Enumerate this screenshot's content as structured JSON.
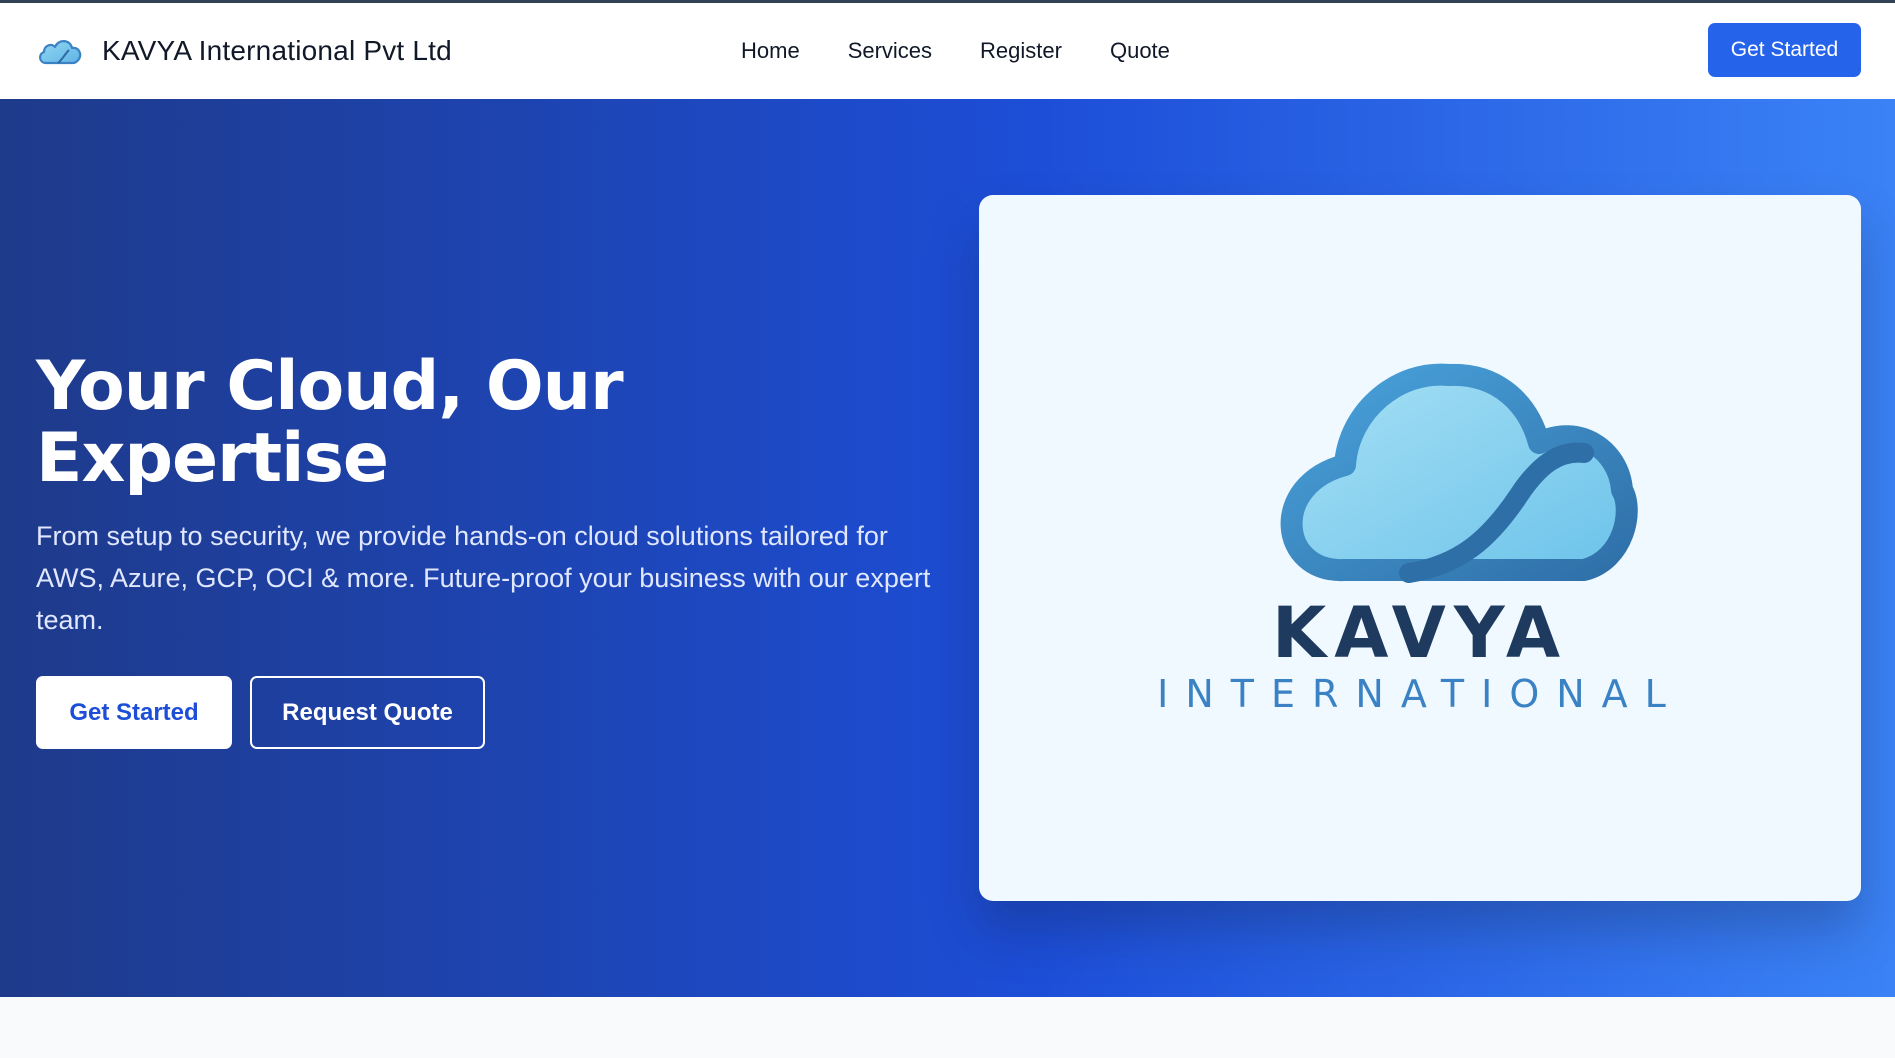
{
  "header": {
    "brand_name": "KAVYA International Pvt Ltd",
    "brand_icon": "cloud-icon",
    "nav": [
      {
        "label": "Home"
      },
      {
        "label": "Services"
      },
      {
        "label": "Register"
      },
      {
        "label": "Quote"
      }
    ],
    "cta_label": "Get Started"
  },
  "hero": {
    "title": "Your Cloud, Our Expertise",
    "description": "From setup to security, we provide hands-on cloud solutions tailored for AWS, Azure, GCP, OCI & more. Future-proof your business with our expert team.",
    "primary_button": "Get Started",
    "secondary_button": "Request Quote"
  },
  "logo": {
    "wordmark_line1": "KAVYA",
    "wordmark_line2": "INTERNATIONAL"
  },
  "colors": {
    "accent": "#2563eb",
    "hero_gradient_start": "#1e3a8a",
    "hero_gradient_end": "#3b82f6",
    "logo_navy": "#1e3a5f",
    "logo_blue": "#3b82c4"
  }
}
